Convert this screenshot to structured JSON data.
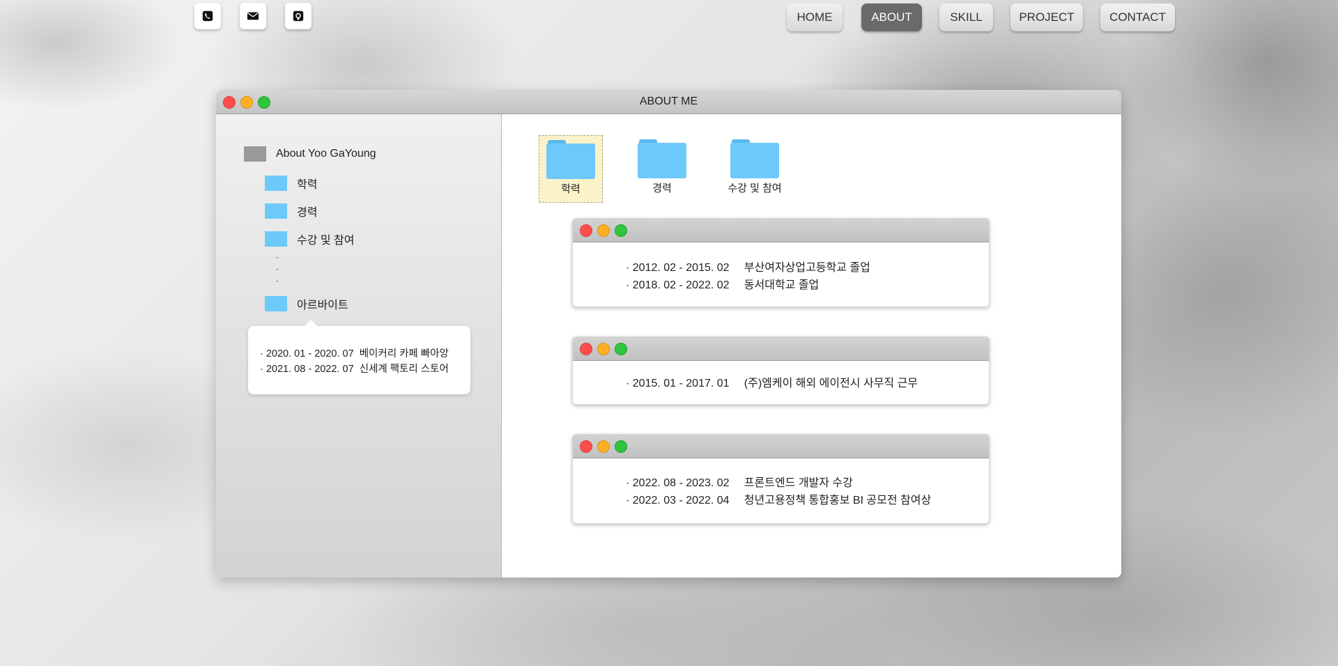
{
  "contact_icons": [
    {
      "name": "phone-icon"
    },
    {
      "name": "mail-icon"
    },
    {
      "name": "github-icon"
    }
  ],
  "nav": [
    {
      "label": "HOME",
      "active": false
    },
    {
      "label": "ABOUT",
      "active": true
    },
    {
      "label": "SKILL",
      "active": false
    },
    {
      "label": "PROJECT",
      "active": false
    },
    {
      "label": "CONTACT",
      "active": false
    }
  ],
  "window": {
    "title": "ABOUT ME"
  },
  "sidebar": {
    "root": "About Yoo GaYoung",
    "items": [
      {
        "label": "학력"
      },
      {
        "label": "경력"
      },
      {
        "label": "수강 및 참여"
      },
      {
        "label": "아르바이트"
      }
    ],
    "dots": [
      "·",
      "·",
      "·"
    ],
    "popover": [
      {
        "date": "2020. 01 - 2020. 07",
        "text": "베이커리 카페 빠아앙"
      },
      {
        "date": "2021. 08 - 2022. 07",
        "text": "신세계 팩토리 스토어"
      }
    ]
  },
  "main": {
    "folders": [
      {
        "label": "학력",
        "selected": true
      },
      {
        "label": "경력",
        "selected": false
      },
      {
        "label": "수강 및 참여",
        "selected": false
      }
    ],
    "cards": [
      {
        "lines": [
          {
            "date": "2012. 02 - 2015. 02",
            "text": "부산여자상업고등학교 졸업"
          },
          {
            "date": "2018. 02 - 2022. 02",
            "text": "동서대학교 졸업"
          }
        ]
      },
      {
        "lines": [
          {
            "date": "2015. 01 - 2017. 01",
            "text": "(주)엠케이 해외 에이전시 사무직 근무"
          }
        ]
      },
      {
        "lines": [
          {
            "date": "2022. 08 - 2023. 02",
            "text": "프론트엔드 개발자 수강"
          },
          {
            "date": "2022. 03 - 2022. 04",
            "text": "청년고용정책 통합홍보 BI 공모전 참여상"
          }
        ]
      }
    ]
  },
  "colors": {
    "folder_blue": "#6ec9fb",
    "folder_gray": "#9a9a9a",
    "nav_active": "#6a6a6a",
    "dot_red": "#fc4f4c",
    "dot_yellow": "#fdaf24",
    "dot_green": "#2fc53c"
  }
}
